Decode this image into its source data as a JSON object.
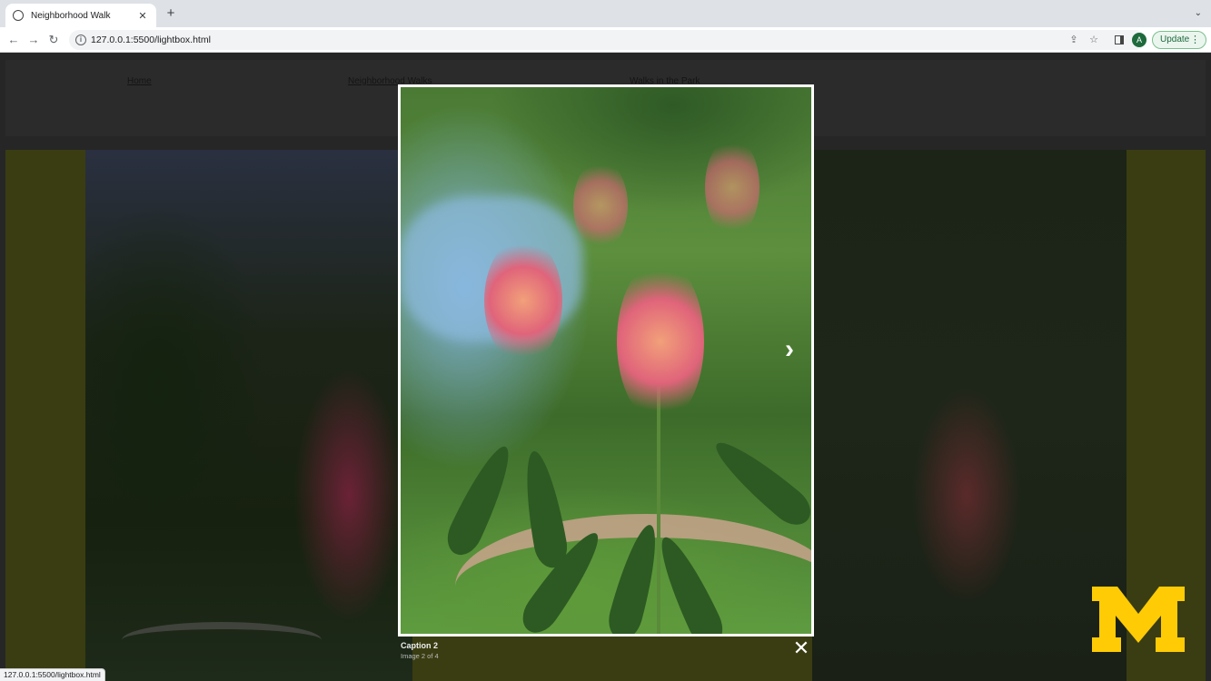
{
  "browser": {
    "tab_title": "Neighborhood Walk",
    "tab_close": "✕",
    "new_tab": "+",
    "tab_menu": "⌄",
    "url": "127.0.0.1:5500/lightbox.html",
    "update_label": "Update",
    "update_menu": "⋮",
    "avatar_letter": "A",
    "status_url": "127.0.0.1:5500/lightbox.html"
  },
  "site_nav": {
    "links": [
      "Home",
      "Neighborhood Walks",
      "Walks in the Park"
    ]
  },
  "lightbox": {
    "caption": "Caption 2",
    "counter": "Image 2 of 4",
    "next_icon": "›",
    "close_icon": "✕"
  },
  "logo": {
    "text": "M",
    "color": "#ffcb05"
  }
}
